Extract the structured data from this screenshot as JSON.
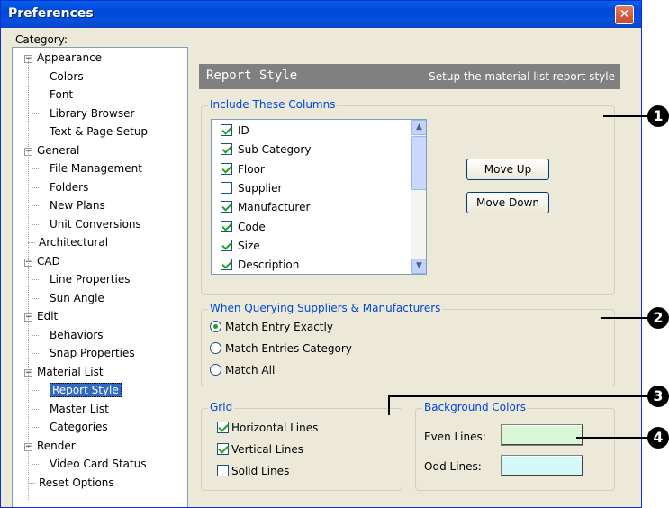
{
  "window": {
    "title": "Preferences",
    "close_glyph": "✕"
  },
  "category_label": "Category:",
  "tree": [
    {
      "label": "Appearance",
      "level": 0,
      "expander": "−"
    },
    {
      "label": "Colors",
      "level": 1
    },
    {
      "label": "Font",
      "level": 1
    },
    {
      "label": "Library Browser",
      "level": 1
    },
    {
      "label": "Text & Page Setup",
      "level": 1
    },
    {
      "label": "General",
      "level": 0,
      "expander": "−"
    },
    {
      "label": "File Management",
      "level": 1
    },
    {
      "label": "Folders",
      "level": 1
    },
    {
      "label": "New Plans",
      "level": 1
    },
    {
      "label": "Unit Conversions",
      "level": 1
    },
    {
      "label": "Architectural",
      "level": 0
    },
    {
      "label": "CAD",
      "level": 0,
      "expander": "−"
    },
    {
      "label": "Line Properties",
      "level": 1
    },
    {
      "label": "Sun Angle",
      "level": 1
    },
    {
      "label": "Edit",
      "level": 0,
      "expander": "−"
    },
    {
      "label": "Behaviors",
      "level": 1
    },
    {
      "label": "Snap Properties",
      "level": 1
    },
    {
      "label": "Material List",
      "level": 0,
      "expander": "−"
    },
    {
      "label": "Report Style",
      "level": 1,
      "selected": true
    },
    {
      "label": "Master List",
      "level": 1
    },
    {
      "label": "Categories",
      "level": 1
    },
    {
      "label": "Render",
      "level": 0,
      "expander": "−"
    },
    {
      "label": "Video Card Status",
      "level": 1
    },
    {
      "label": "Reset Options",
      "level": 0
    }
  ],
  "panel": {
    "title": "Report Style",
    "subtitle": "Setup the material list report style"
  },
  "columns_group": {
    "legend": "Include These Columns",
    "items": [
      {
        "label": "ID",
        "checked": true
      },
      {
        "label": "Sub Category",
        "checked": true
      },
      {
        "label": "Floor",
        "checked": true
      },
      {
        "label": "Supplier",
        "checked": false
      },
      {
        "label": "Manufacturer",
        "checked": true
      },
      {
        "label": "Code",
        "checked": true
      },
      {
        "label": "Size",
        "checked": true
      },
      {
        "label": "Description",
        "checked": true
      }
    ],
    "move_up": "Move Up",
    "move_down": "Move Down",
    "scroll_up_glyph": "▲",
    "scroll_down_glyph": "▼"
  },
  "query_group": {
    "legend": "When Querying Suppliers & Manufacturers",
    "options": [
      {
        "label": "Match Entry Exactly",
        "selected": true
      },
      {
        "label": "Match Entries Category",
        "selected": false
      },
      {
        "label": "Match All",
        "selected": false
      }
    ]
  },
  "grid_group": {
    "legend": "Grid",
    "items": [
      {
        "label": "Horizontal Lines",
        "checked": true
      },
      {
        "label": "Vertical Lines",
        "checked": true
      },
      {
        "label": "Solid Lines",
        "checked": false
      }
    ]
  },
  "bg_group": {
    "legend": "Background Colors",
    "even_label": "Even Lines:",
    "odd_label": "Odd Lines:",
    "even_color": "#d9f7d4",
    "odd_color": "#d4f7f7"
  },
  "callouts": [
    "1",
    "2",
    "3",
    "4"
  ]
}
